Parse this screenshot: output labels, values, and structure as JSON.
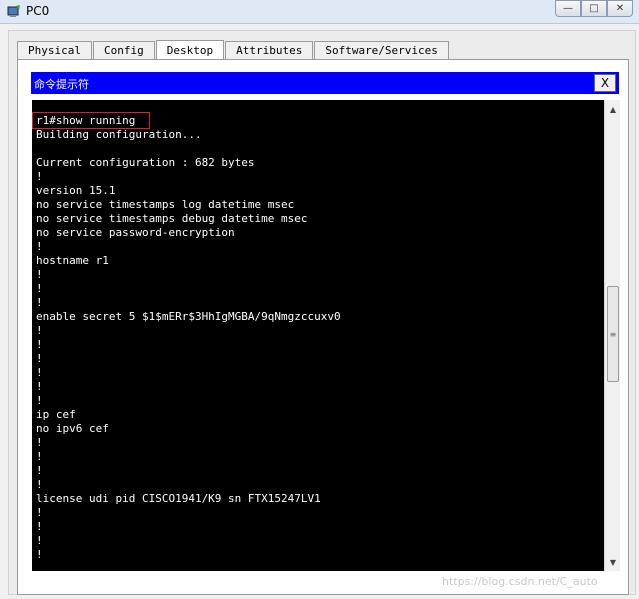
{
  "window": {
    "title": "PC0",
    "minimize_glyph": "—",
    "maximize_glyph": "□",
    "close_glyph": "✕"
  },
  "tabs": [
    {
      "label": "Physical",
      "active": false
    },
    {
      "label": "Config",
      "active": false
    },
    {
      "label": "Desktop",
      "active": true
    },
    {
      "label": "Attributes",
      "active": false
    },
    {
      "label": "Software/Services",
      "active": false
    }
  ],
  "cmd": {
    "title": "命令提示符",
    "close_label": "X",
    "lines": [
      "r1#show running",
      "Building configuration...",
      "",
      "Current configuration : 682 bytes",
      "!",
      "version 15.1",
      "no service timestamps log datetime msec",
      "no service timestamps debug datetime msec",
      "no service password-encryption",
      "!",
      "hostname r1",
      "!",
      "!",
      "!",
      "enable secret 5 $1$mERr$3HhIgMGBA/9qNmgzccuxv0",
      "!",
      "!",
      "!",
      "!",
      "!",
      "!",
      "ip cef",
      "no ipv6 cef",
      "!",
      "!",
      "!",
      "!",
      "license udi pid CISCO1941/K9 sn FTX15247LV1",
      "!",
      "!",
      "!",
      "!"
    ]
  },
  "scrollbar": {
    "up_glyph": "▲",
    "down_glyph": "▼",
    "thumb_glyph": "≡"
  },
  "watermark": "https://blog.csdn.net/C_auto",
  "colors": {
    "cmd_titlebar": "#0000ff",
    "terminal_bg": "#000000",
    "terminal_text": "#ffffff",
    "highlight": "#e02020"
  }
}
